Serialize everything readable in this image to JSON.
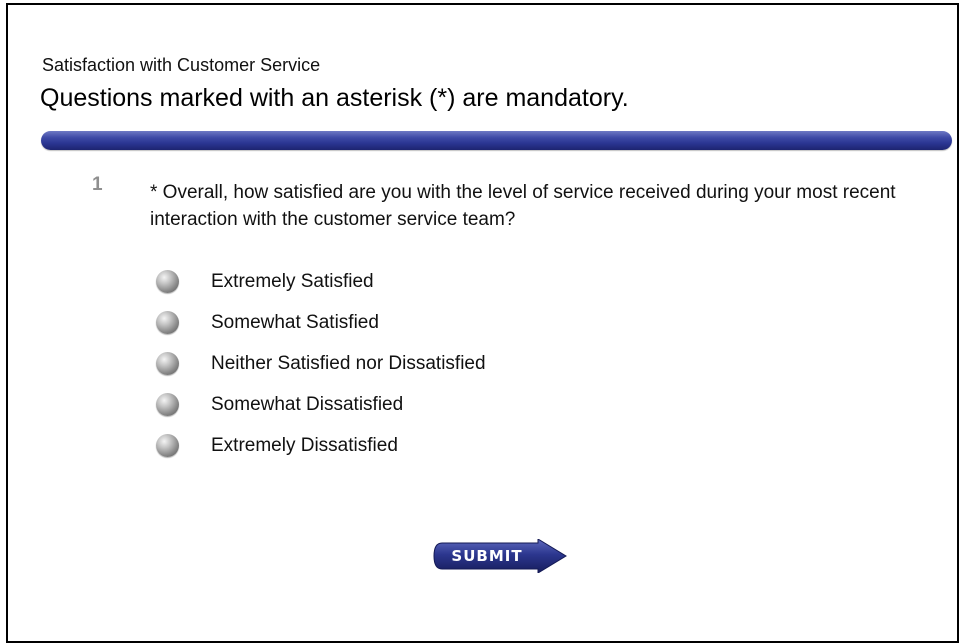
{
  "survey": {
    "title": "Satisfaction with Customer Service",
    "mandatory_note": "Questions marked with an asterisk (*) are mandatory."
  },
  "question": {
    "number": "1",
    "text": "* Overall, how satisfied are you with the level of service received during your most recent interaction with the customer service team?",
    "options": [
      {
        "label": "Extremely Satisfied"
      },
      {
        "label": "Somewhat Satisfied"
      },
      {
        "label": "Neither Satisfied nor Dissatisfied"
      },
      {
        "label": "Somewhat Dissatisfied"
      },
      {
        "label": "Extremely Dissatisfied"
      }
    ]
  },
  "submit": {
    "label": "SUBMIT",
    "icon": "arrow-right-icon"
  },
  "colors": {
    "bar": "#2a3592",
    "button": "#232c7c"
  }
}
